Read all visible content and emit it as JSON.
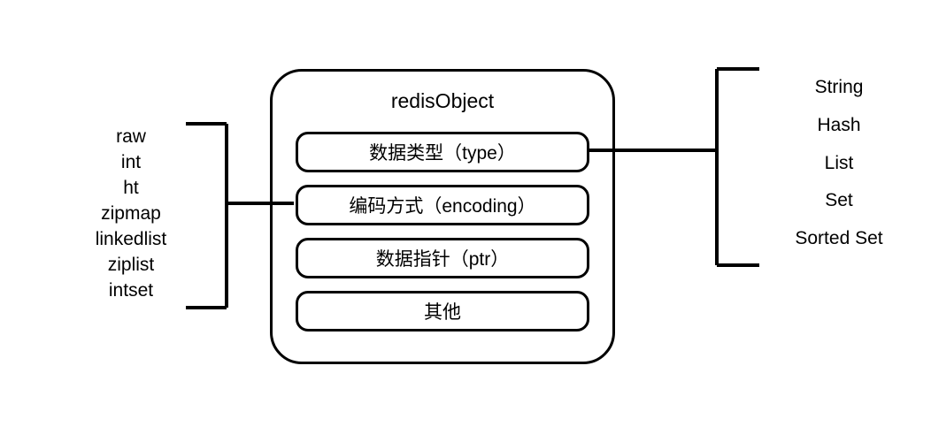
{
  "center": {
    "title": "redisObject",
    "fields": [
      "数据类型（type）",
      "编码方式（encoding）",
      "数据指针（ptr）",
      "其他"
    ]
  },
  "left_encodings": [
    "raw",
    "int",
    "ht",
    "zipmap",
    "linkedlist",
    "ziplist",
    "intset"
  ],
  "right_types": [
    "String",
    "Hash",
    "List",
    "Set",
    "Sorted Set"
  ]
}
